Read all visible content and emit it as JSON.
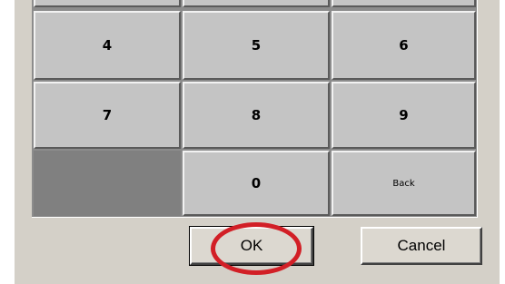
{
  "keypad": {
    "keys": [
      "4",
      "5",
      "6",
      "7",
      "8",
      "9",
      "0",
      "Back"
    ]
  },
  "buttons": {
    "ok": "OK",
    "cancel": "Cancel"
  },
  "annotation": {
    "highlight_color": "#d21f26"
  }
}
